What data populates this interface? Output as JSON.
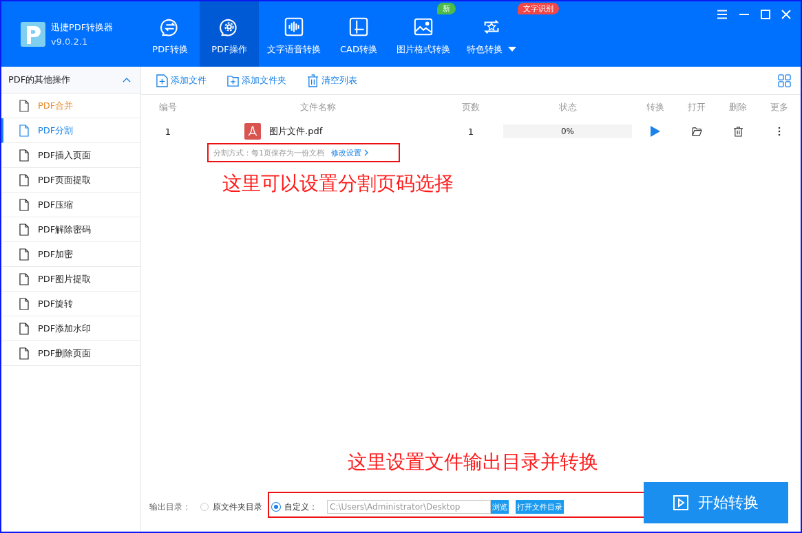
{
  "app": {
    "name": "迅捷PDF转换器",
    "version": "v9.0.2.1"
  },
  "nav": [
    {
      "label": "PDF转换",
      "selected": false
    },
    {
      "label": "PDF操作",
      "selected": true
    },
    {
      "label": "文字语音转换",
      "selected": false
    },
    {
      "label": "CAD转换",
      "selected": false
    },
    {
      "label": "图片格式转换",
      "selected": false,
      "badge": {
        "text": "新",
        "color": "#4cbb4a"
      }
    },
    {
      "label": "特色转换",
      "selected": false,
      "badge": {
        "text": "文字识别",
        "color": "#f04848"
      },
      "dropdown": true
    }
  ],
  "sidebar": {
    "title": "PDF的其他操作",
    "expanded": true,
    "items": [
      {
        "label": "PDF合并",
        "selected": false,
        "hovered": true
      },
      {
        "label": "PDF分割",
        "selected": true,
        "hovered": false
      },
      {
        "label": "PDF插入页面",
        "selected": false,
        "hovered": false
      },
      {
        "label": "PDF页面提取",
        "selected": false,
        "hovered": false
      },
      {
        "label": "PDF压缩",
        "selected": false,
        "hovered": false
      },
      {
        "label": "PDF解除密码",
        "selected": false,
        "hovered": false
      },
      {
        "label": "PDF加密",
        "selected": false,
        "hovered": false
      },
      {
        "label": "PDF图片提取",
        "selected": false,
        "hovered": false
      },
      {
        "label": "PDF旋转",
        "selected": false,
        "hovered": false
      },
      {
        "label": "PDF添加水印",
        "selected": false,
        "hovered": false
      },
      {
        "label": "PDF删除页面",
        "selected": false,
        "hovered": false
      }
    ]
  },
  "toolbar": [
    "添加文件",
    "添加文件夹",
    "清空列表"
  ],
  "table": {
    "columns": [
      "编号",
      "文件名称",
      "页数",
      "状态",
      "转换",
      "打开",
      "删除",
      "更多"
    ],
    "rows": [
      {
        "number": "1",
        "file_name": "图片文件.pdf",
        "pages": "1",
        "level": 0,
        "status": "0%",
        "split_method": "分割方式：每1页保存为一份文档",
        "modify_link": "修改设置"
      }
    ]
  },
  "annotations": [
    "这里可以设置分割页码选择",
    "这里设置文件输出目录并转换"
  ],
  "output": {
    "label": "输出目录：",
    "options": [
      {
        "label": "原文件夹目录",
        "selected": false
      },
      {
        "label": "自定义：",
        "selected": true
      }
    ],
    "path": "C:\\Users\\Administrator\\Desktop",
    "browse": "浏览",
    "open_folder": "打开文件目录"
  },
  "start_button": "开始转换"
}
